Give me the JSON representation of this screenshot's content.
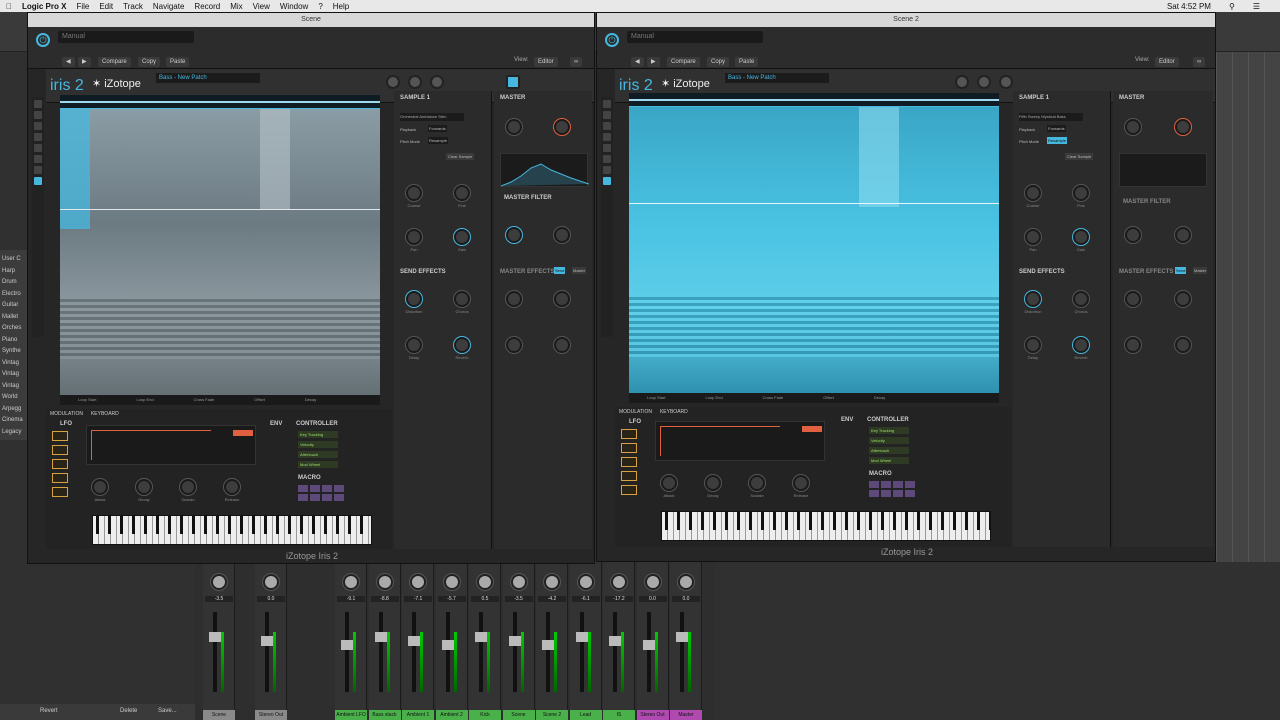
{
  "menubar": {
    "app": "Logic Pro X",
    "items": [
      "File",
      "Edit",
      "Track",
      "Navigate",
      "Record",
      "Mix",
      "View",
      "Window",
      "?",
      "Help"
    ],
    "time": "Sat 4:52 PM"
  },
  "logic_tracks": [
    "User C",
    "Harp",
    "Drum",
    "Electro",
    "Guitar",
    "Mallet",
    "Orches",
    "Piano",
    "Synthe",
    "Vintag",
    "Vintag",
    "Vintag",
    "World",
    "Arpegg",
    "Cinema",
    "Legacy"
  ],
  "left_plugin": {
    "title": "Scene",
    "preset": "Manual",
    "compare": "Compare",
    "copy": "Copy",
    "paste": "Paste",
    "view_label": "View:",
    "view_value": "Editor",
    "logo": "iris 2",
    "brand": "iZotope",
    "patch": "Bass - New Patch",
    "sample_title": "SAMPLE 1",
    "master_title": "MASTER",
    "master_filter": "MASTER FILTER",
    "send_effects": "SEND EFFECTS",
    "master_effects": "MASTER EFFECTS",
    "send_btn": "Send",
    "master_btn": "Master",
    "modulation_tab": "MODULATION",
    "keyboard_tab": "KEYBOARD",
    "lfo": "LFO",
    "env": "ENV",
    "controller": "CONTROLLER",
    "macro": "MACRO",
    "ctrl_items": [
      "Key Tracking",
      "Velocity",
      "Aftertouch",
      "Mod Wheel"
    ],
    "env_knobs": [
      "Attack",
      "Decay",
      "Sustain",
      "Release"
    ],
    "footer": "iZotope Iris 2",
    "sample_name": "Orchestral Ambiance Strin",
    "playback": "Playback",
    "playback_val": "Forwards",
    "pitch_mode": "Pitch Mode",
    "pitch_val": "Resample",
    "clear_sample": "Clear Sample",
    "sample_knobs": [
      "Coarse",
      "Fine",
      "Pan",
      "Gain"
    ],
    "send_knobs": [
      "Distortion",
      "Chorus",
      "Delay",
      "Reverb"
    ],
    "spectro_foot": [
      "Loop Start",
      "Loop End",
      "Cross Fade",
      "Offset",
      "Decay"
    ]
  },
  "right_plugin": {
    "title": "Scene 2",
    "preset": "Manual",
    "compare": "Compare",
    "copy": "Copy",
    "paste": "Paste",
    "view_label": "View:",
    "view_value": "Editor",
    "logo": "iris 2",
    "brand": "iZotope",
    "patch": "Bass - New Patch",
    "sample_title": "SAMPLE 1",
    "master_title": "MASTER",
    "master_filter": "MASTER FILTER",
    "send_effects": "SEND EFFECTS",
    "master_effects": "MASTER EFFECTS",
    "send_btn": "Send",
    "master_btn": "Master",
    "modulation_tab": "MODULATION",
    "keyboard_tab": "KEYBOARD",
    "lfo": "LFO",
    "env": "ENV",
    "controller": "CONTROLLER",
    "macro": "MACRO",
    "ctrl_items": [
      "Key Tracking",
      "Velocity",
      "Aftertouch",
      "Mod Wheel"
    ],
    "env_knobs": [
      "Attack",
      "Decay",
      "Sustain",
      "Release"
    ],
    "footer": "iZotope Iris 2",
    "sample_name": "Fifth Sweep Mystical Bass",
    "playback": "Playback",
    "playback_val": "Forwards",
    "pitch_mode": "Pitch Mode",
    "pitch_val": "Resample",
    "clear_sample": "Clear Sample",
    "sample_knobs": [
      "Coarse",
      "Fine",
      "Pan",
      "Gain"
    ],
    "send_knobs": [
      "Distortion",
      "Chorus",
      "Delay",
      "Reverb"
    ],
    "spectro_foot": [
      "Loop Start",
      "Loop End",
      "Cross Fade",
      "Offset",
      "Decay"
    ]
  },
  "mixer": {
    "strips": [
      {
        "name": "Scene",
        "val": "-3.5",
        "color": "#8a8a8a"
      },
      {
        "name": "Stereo Out",
        "val": "0.0",
        "color": "#8a8a8a"
      },
      {
        "name": "Ambient LFO",
        "val": "-9.1",
        "color": "#4ab04a"
      },
      {
        "name": "Bass stack",
        "val": "-8.8",
        "color": "#4ab04a"
      },
      {
        "name": "Ambient 1",
        "val": "-7.1",
        "color": "#4ab04a"
      },
      {
        "name": "Ambient 2",
        "val": "-5.7",
        "color": "#4ab04a"
      },
      {
        "name": "Kick",
        "val": "0.5",
        "color": "#4ab04a"
      },
      {
        "name": "Scene",
        "val": "-3.5",
        "color": "#4ab04a"
      },
      {
        "name": "Scene 2",
        "val": "-4.2",
        "color": "#4ab04a"
      },
      {
        "name": "Lead",
        "val": "-6.1",
        "color": "#4ab04a"
      },
      {
        "name": "IS",
        "val": "-17.2",
        "color": "#4ab04a"
      },
      {
        "name": "Stereo Out",
        "val": "0.0",
        "color": "#b04ab0"
      },
      {
        "name": "Master",
        "val": "0.0",
        "color": "#b04ab0"
      }
    ]
  },
  "bottom_bar": {
    "revert": "Revert",
    "delete": "Delete",
    "save": "Save..."
  },
  "colors": {
    "accent": "#46b8e0",
    "env": "#e06040",
    "ctrl": "#9ee06c",
    "macro": "#5d4a7a"
  }
}
